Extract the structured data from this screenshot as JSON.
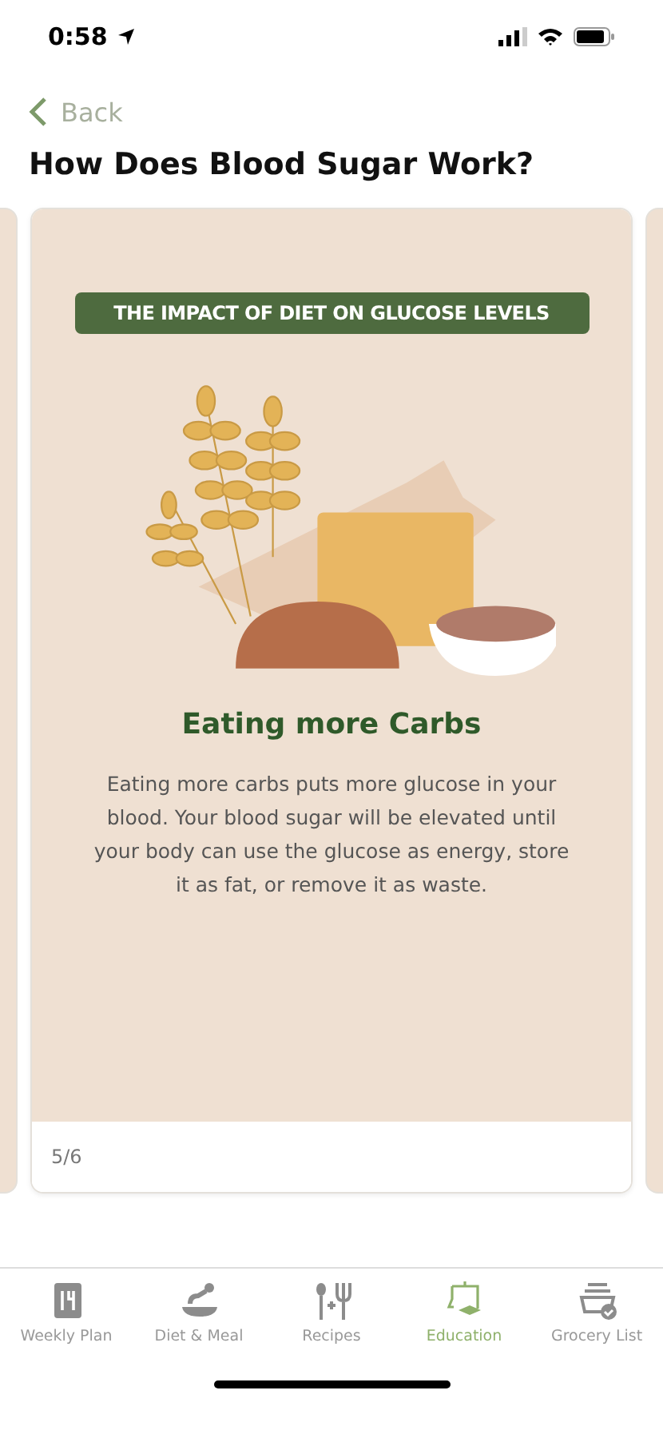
{
  "status_bar": {
    "time": "0:58"
  },
  "back": {
    "label": "Back"
  },
  "title": "How Does Blood Sugar Work?",
  "card": {
    "banner": "THE IMPACT OF DIET ON GLUCOSE LEVELS",
    "heading": "Eating more Carbs",
    "body": "Eating more carbs puts more glucose in your blood. Your blood sugar will be elevated until your body can use the glucose as energy, store it as fat, or remove it as waste.",
    "page": "5/6"
  },
  "tabs": [
    {
      "kind": "plan",
      "label": "Weekly Plan",
      "selected": false
    },
    {
      "kind": "meal",
      "label": "Diet & Meal",
      "selected": false
    },
    {
      "kind": "recipes",
      "label": "Recipes",
      "selected": false
    },
    {
      "kind": "education",
      "label": "Education",
      "selected": true
    },
    {
      "kind": "grocery",
      "label": "Grocery List",
      "selected": false
    }
  ]
}
